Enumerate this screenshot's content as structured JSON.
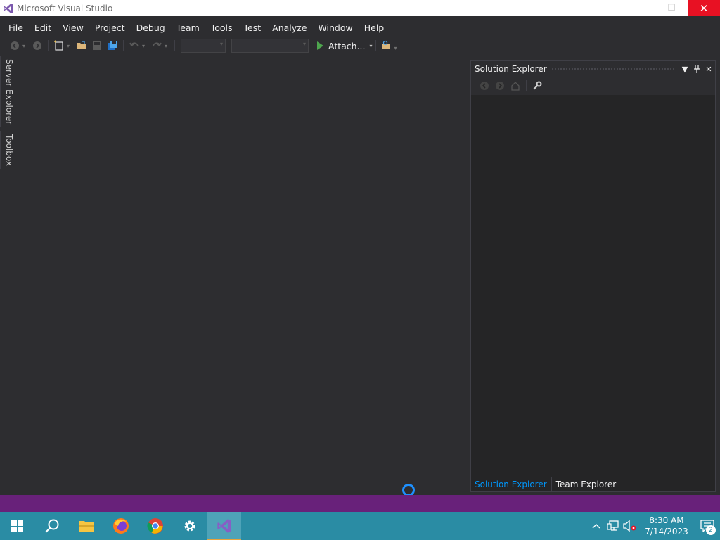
{
  "window": {
    "title": "Microsoft Visual Studio",
    "minimize_glyph": "—",
    "maximize_glyph": "☐",
    "close_glyph": "✕"
  },
  "menu": {
    "items": [
      "File",
      "Edit",
      "View",
      "Project",
      "Debug",
      "Team",
      "Tools",
      "Test",
      "Analyze",
      "Window",
      "Help"
    ]
  },
  "toolbar": {
    "attach_label": "Attach..."
  },
  "side_tabs": {
    "server_explorer": "Server Explorer",
    "toolbox": "Toolbox"
  },
  "solution_explorer": {
    "title": "Solution Explorer",
    "bottom_tabs": [
      "Solution Explorer",
      "Team Explorer"
    ]
  },
  "taskbar": {
    "time": "8:30 AM",
    "date": "7/14/2023",
    "notification_count": "2"
  },
  "colors": {
    "accent_status": "#68217a",
    "taskbar": "#2a8ca4",
    "active_tab": "#0097fb",
    "spinner": "#1e90ff"
  }
}
